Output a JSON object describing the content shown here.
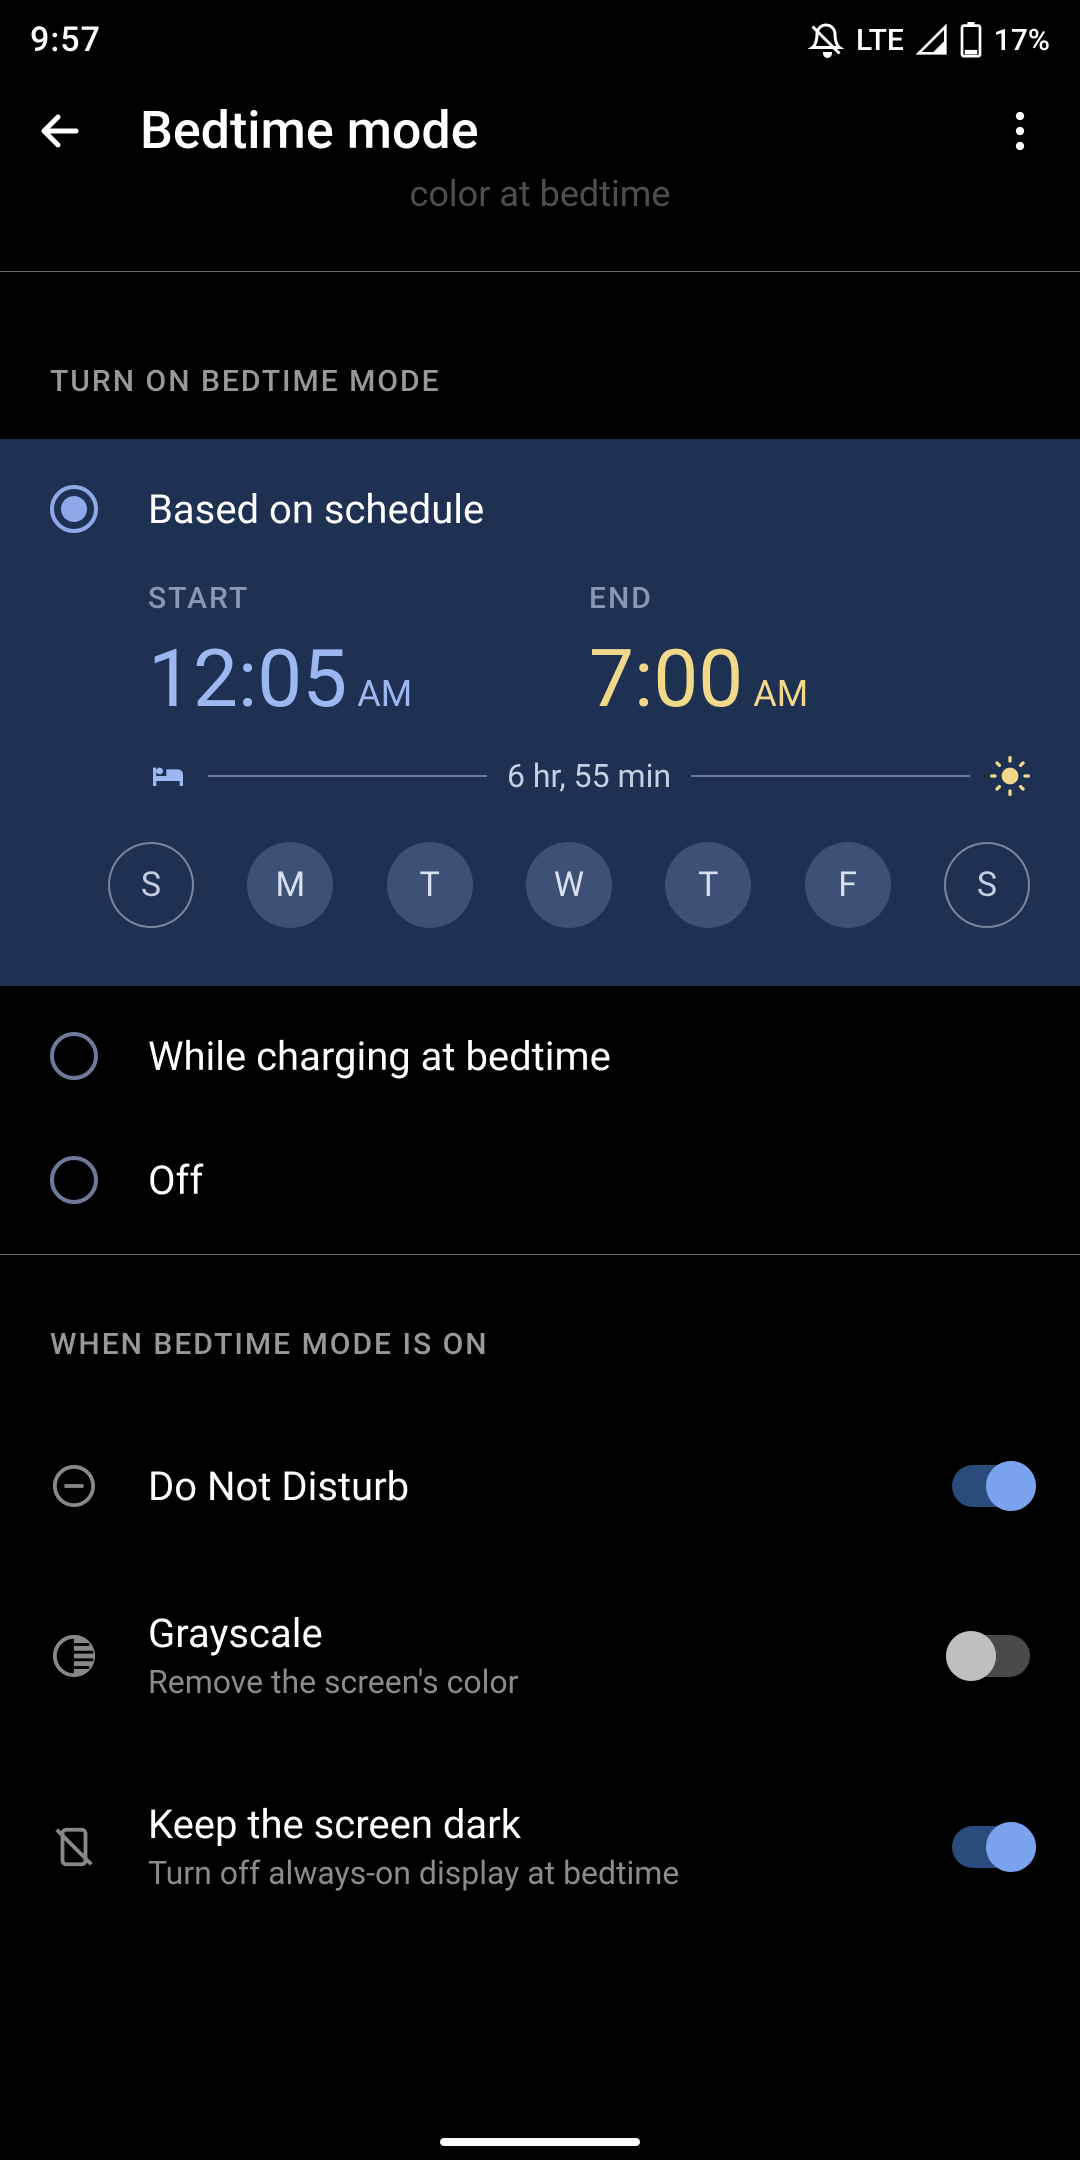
{
  "status": {
    "time": "9:57",
    "network": "LTE",
    "battery": "17%"
  },
  "header": {
    "title": "Bedtime mode",
    "scrolled_hint": "color at bedtime"
  },
  "sections": {
    "turn_on_label": "Turn on Bedtime mode",
    "when_on_label": "When Bedtime mode is on"
  },
  "mode_options": {
    "schedule": {
      "label": "Based on schedule",
      "selected": true
    },
    "charging": {
      "label": "While charging at bedtime",
      "selected": false
    },
    "off": {
      "label": "Off",
      "selected": false
    }
  },
  "schedule": {
    "start_label": "START",
    "end_label": "END",
    "start_time": "12:05",
    "start_ampm": "AM",
    "end_time": "7:00",
    "end_ampm": "AM",
    "duration": "6 hr, 55 min",
    "days": [
      {
        "letter": "S",
        "on": false
      },
      {
        "letter": "M",
        "on": true
      },
      {
        "letter": "T",
        "on": true
      },
      {
        "letter": "W",
        "on": true
      },
      {
        "letter": "T",
        "on": true
      },
      {
        "letter": "F",
        "on": true
      },
      {
        "letter": "S",
        "on": false
      }
    ]
  },
  "when_on": {
    "dnd": {
      "title": "Do Not Disturb",
      "on": true
    },
    "grayscale": {
      "title": "Grayscale",
      "sub": "Remove the screen's color",
      "on": false
    },
    "screen_dark": {
      "title": "Keep the screen dark",
      "sub": "Turn off always-on display at bedtime",
      "on": true
    }
  }
}
